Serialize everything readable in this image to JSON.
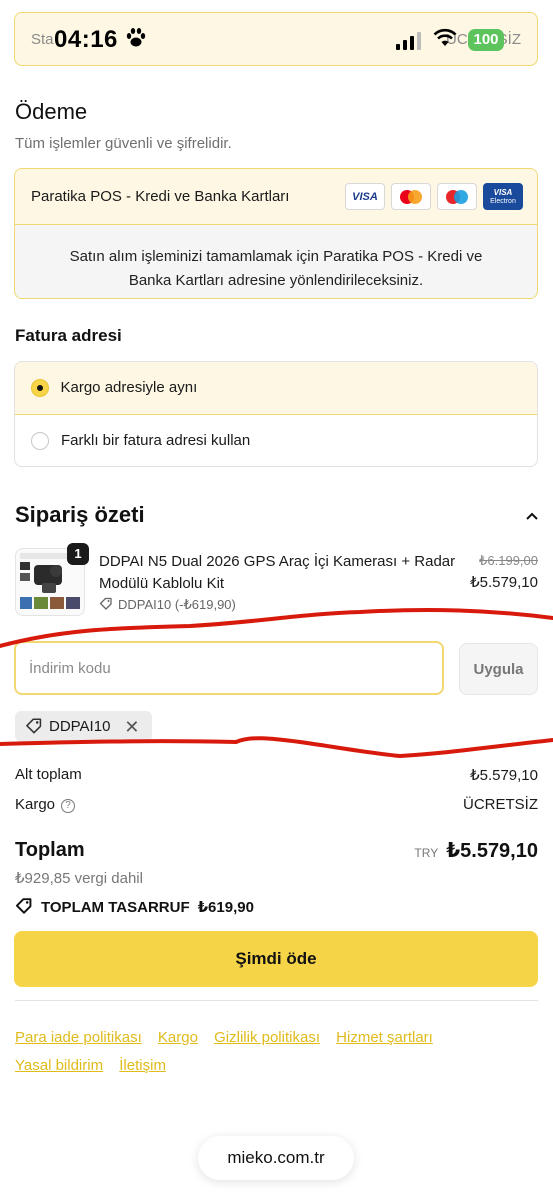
{
  "status_bar": {
    "time": "04:16",
    "battery": "100",
    "paw_icon": "paw-icon"
  },
  "top_strip": {
    "left_text": "Sta",
    "right_text": "ÜCRETSİZ"
  },
  "payment": {
    "title": "Ödeme",
    "subtitle": "Tüm işlemler güvenli ve şifrelidir.",
    "method_name": "Paratika POS - Kredi ve Banka Kartları",
    "card_visa": "VISA",
    "card_visa_electron_1": "VISA",
    "card_visa_electron_2": "Electron",
    "redirect_message": "Satın alım işleminizi tamamlamak için Paratika POS - Kredi ve Banka Kartları adresine yönlendirileceksiniz."
  },
  "billing": {
    "title": "Fatura adresi",
    "options": [
      {
        "label": "Kargo adresiyle aynı",
        "selected": true
      },
      {
        "label": "Farklı bir fatura adresi kullan",
        "selected": false
      }
    ]
  },
  "summary": {
    "title": "Sipariş özeti",
    "product": {
      "quantity": "1",
      "name": "DDPAI N5 Dual 2026 GPS Araç İçi Kamerası + Radar Modülü Kablolu Kit",
      "discount": "DDPAI10 (-₺619,90)",
      "price_old": "₺6.199,00",
      "price_new": "₺5.579,10"
    },
    "discount_placeholder": "İndirim kodu",
    "apply_label": "Uygula",
    "applied_code": "DDPAI10",
    "subtotal_label": "Alt toplam",
    "subtotal_value": "₺5.579,10",
    "shipping_label": "Kargo",
    "shipping_value": "ÜCRETSİZ",
    "total_label": "Toplam",
    "total_currency": "TRY",
    "total_value": "₺5.579,10",
    "tax_note": "₺929,85 vergi dahil",
    "savings_label": "TOPLAM TASARRUF",
    "savings_value": "₺619,90",
    "pay_button": "Şimdi öde"
  },
  "footer_links": [
    "Para iade politikası",
    "Kargo",
    "Gizlilik politikası",
    "Hizmet şartları",
    "Yasal bildirim",
    "İletişim"
  ],
  "url_bar": "mieko.com.tr",
  "colors": {
    "accent_yellow": "#f5d547",
    "border_yellow": "#f1d873",
    "light_yellow": "#fdf7e3",
    "link_yellow": "#e0bb1c",
    "annotation_red": "#d81a0c"
  }
}
